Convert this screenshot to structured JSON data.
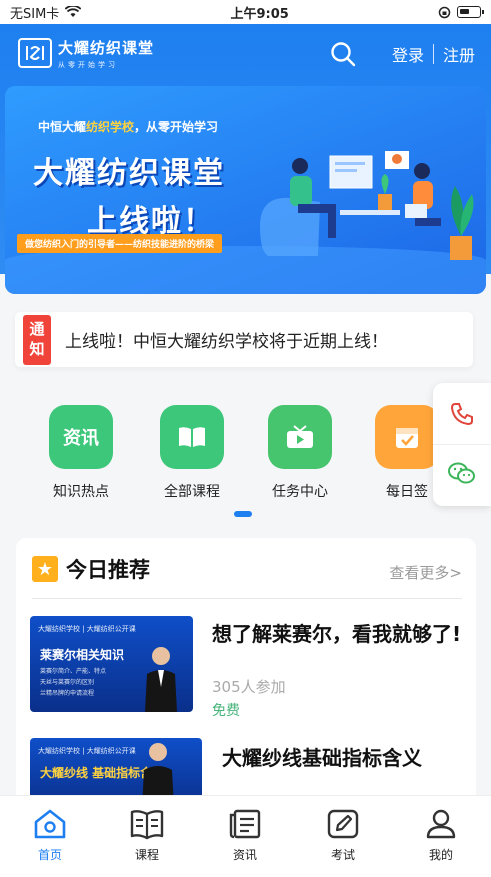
{
  "status": {
    "carrier": "无SIM卡",
    "time": "上午9:05"
  },
  "header": {
    "logo_title": "大耀纺织课堂",
    "logo_tagline": "从零开始学习",
    "login": "登录",
    "register": "注册"
  },
  "banner": {
    "subtitle_prefix": "中恒大耀",
    "subtitle_highlight": "纺织学校",
    "subtitle_suffix": "，从零开始学习",
    "title_line1": "大耀纺织课堂",
    "title_line2": "上线啦！",
    "strip": "做您纺织入门的引导者——纺织技能进阶的桥梁"
  },
  "notice": {
    "badge": "通知",
    "text": "上线啦！中恒大耀纺织学校将于近期上线！"
  },
  "grid": [
    {
      "label": "知识热点",
      "icon_text": "资讯",
      "icon": "news-icon",
      "color": "#3cc77a"
    },
    {
      "label": "全部课程",
      "icon_text": "",
      "icon": "book-icon",
      "color": "#3cc77a"
    },
    {
      "label": "任务中心",
      "icon_text": "",
      "icon": "tv-icon",
      "color": "#46c46e"
    },
    {
      "label": "每日签",
      "icon_text": "",
      "icon": "calendar-icon",
      "color": "#ffa53a"
    }
  ],
  "float": {
    "phone_icon": "phone-icon",
    "wechat_icon": "wechat-icon"
  },
  "recommend": {
    "title": "今日推荐",
    "more": "查看更多>",
    "courses": [
      {
        "title": "想了解莱赛尔，看我就够了!",
        "participants": "305人参加",
        "price": "免费",
        "thumb_label": "莱赛尔相关知识",
        "thumb_header": "大耀纺织学校 | 大耀纺织公开课",
        "thumb_lines": [
          "莱赛尔简介、产能、特点",
          "天丝与莱赛尔的区别",
          "兰精吊牌的申请流程"
        ]
      },
      {
        "title": "大耀纱线基础指标含义",
        "participants": "",
        "price": "",
        "thumb_label": "大耀纱线 基础指标含义",
        "thumb_header": "大耀纺织学校 | 大耀纺织公开课",
        "thumb_lines": []
      }
    ]
  },
  "tabs": [
    {
      "label": "首页",
      "icon": "home-icon",
      "active": true
    },
    {
      "label": "课程",
      "icon": "course-book-icon",
      "active": false
    },
    {
      "label": "资讯",
      "icon": "news-list-icon",
      "active": false
    },
    {
      "label": "考试",
      "icon": "exam-edit-icon",
      "active": false
    },
    {
      "label": "我的",
      "icon": "user-icon",
      "active": false
    }
  ],
  "colors": {
    "primary": "#1e7ff0",
    "notice_red": "#f0443a",
    "free_green": "#47b47a",
    "star_orange": "#ffb01c"
  }
}
